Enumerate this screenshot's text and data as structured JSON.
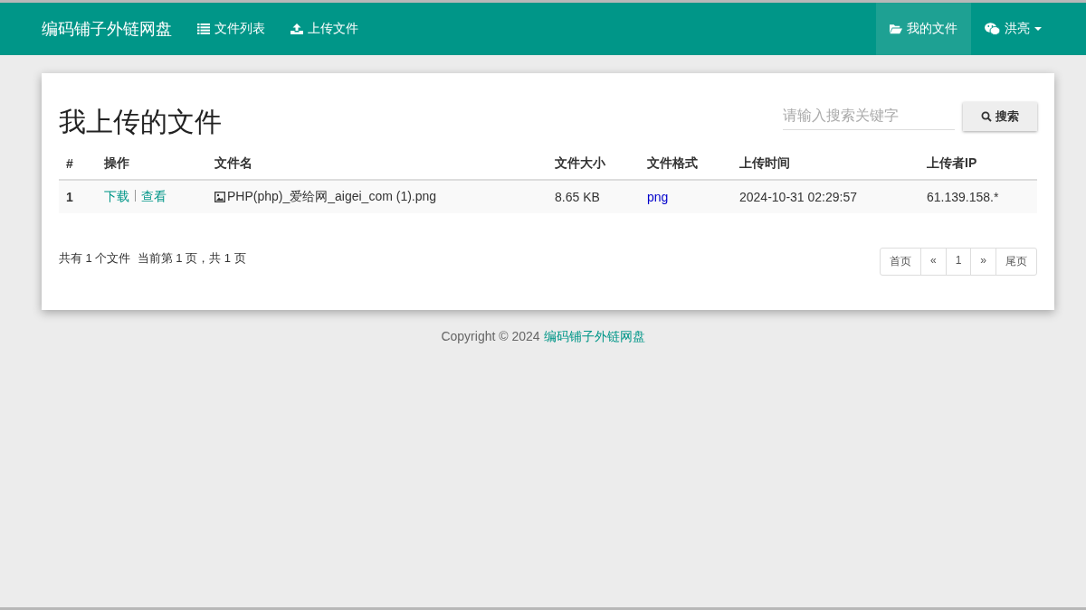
{
  "navbar": {
    "brand": "编码铺子外链网盘",
    "left_items": [
      {
        "label": "文件列表",
        "kind": "list",
        "selected": false
      },
      {
        "label": "上传文件",
        "kind": "upload",
        "selected": false
      }
    ],
    "right_items": [
      {
        "label": "我的文件",
        "kind": "files",
        "selected": true,
        "dropdown": false
      },
      {
        "label": "洪亮",
        "kind": "user",
        "selected": false,
        "dropdown": true
      }
    ]
  },
  "page_title": "我上传的文件",
  "search": {
    "placeholder": "请输入搜索关键字",
    "button": "搜索"
  },
  "table": {
    "columns": [
      "#",
      "操作",
      "文件名",
      "文件大小",
      "文件格式",
      "上传时间",
      "上传者IP"
    ],
    "rows": [
      {
        "index": "1",
        "actions": [
          "下载",
          "查看"
        ],
        "file_name": "PHP(php)_爱给网_aigei_com (1).png",
        "size": "8.65 KB",
        "format": "png",
        "time": "2024-10-31 02:29:57",
        "ip": "61.139.158.*"
      }
    ]
  },
  "summary": "共有 1 个文件  当前第 1 页，共 1 页",
  "pagination": [
    "首页",
    "«",
    "1",
    "»",
    "尾页"
  ],
  "footer": {
    "text": "Copyright © 2024",
    "link": "编码铺子外链网盘"
  }
}
